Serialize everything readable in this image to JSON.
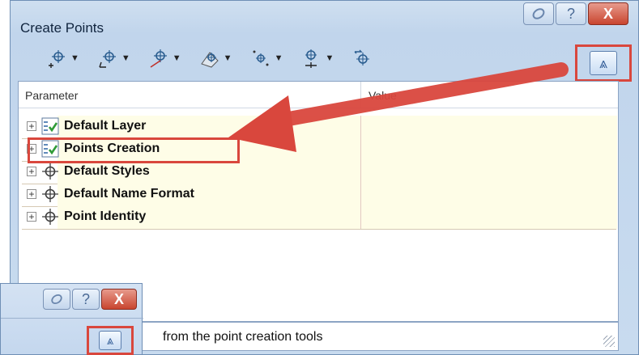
{
  "window": {
    "title": "Create Points",
    "pin_icon": "pin-icon",
    "help_label": "?",
    "close_label": "X"
  },
  "toolbar": {
    "tools": [
      {
        "icon": "point-create-icon",
        "dropdown": "▼"
      },
      {
        "icon": "point-import-icon",
        "dropdown": "▼"
      },
      {
        "icon": "point-slope-icon",
        "dropdown": "▼"
      },
      {
        "icon": "point-surface-icon",
        "dropdown": "▼"
      },
      {
        "icon": "point-interpolate-icon",
        "dropdown": "▼"
      },
      {
        "icon": "point-alignment-icon",
        "dropdown": "▼"
      },
      {
        "icon": "point-convert-icon",
        "dropdown": ""
      }
    ],
    "collapse_label": "⩓"
  },
  "grid": {
    "header": {
      "parameter": "Parameter",
      "value": "Value"
    },
    "rows": [
      {
        "label": "Default Layer",
        "icon": "layer-check-icon",
        "expander": "+"
      },
      {
        "label": "Points Creation",
        "icon": "layer-check-icon",
        "expander": "+"
      },
      {
        "label": "Default Styles",
        "icon": "point-marker-icon",
        "expander": "+"
      },
      {
        "label": "Default Name Format",
        "icon": "point-marker-icon",
        "expander": "+"
      },
      {
        "label": "Point Identity",
        "icon": "point-marker-icon",
        "expander": "+"
      }
    ]
  },
  "status": {
    "text": "from the point creation tools"
  },
  "inset": {
    "help_label": "?",
    "close_label": "X",
    "collapse_label": "⩓"
  },
  "colors": {
    "highlight": "#d9473d",
    "row_background": "#fefde7",
    "window_chrome": "#c8dbef"
  }
}
